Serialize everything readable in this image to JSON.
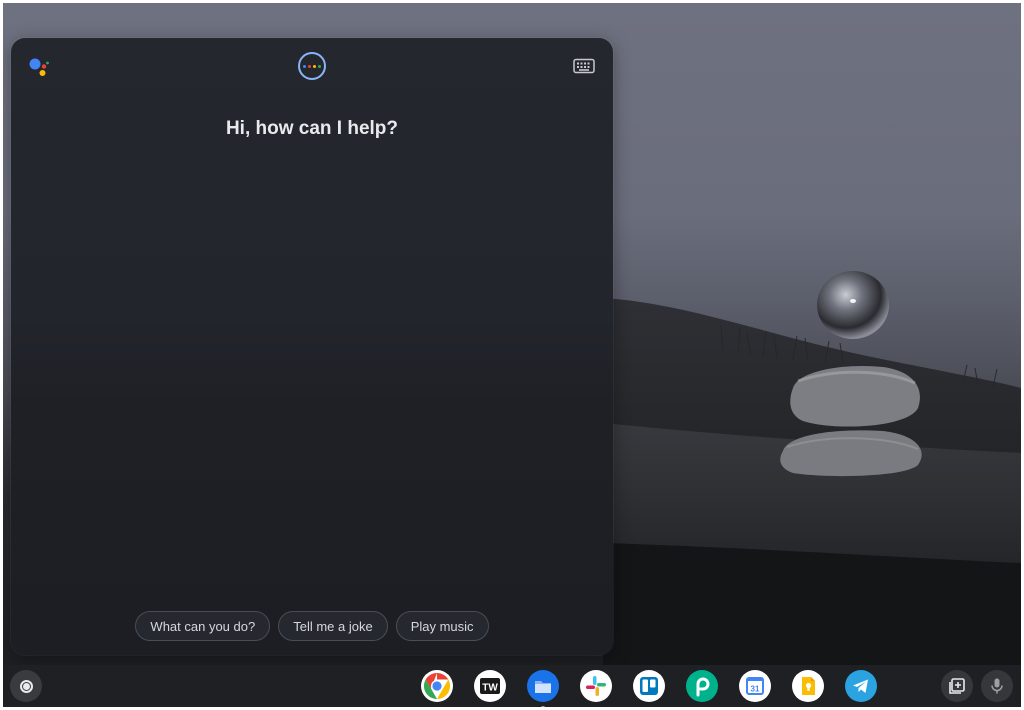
{
  "assistant": {
    "greeting": "Hi, how can I help?",
    "suggestions": [
      "What can you do?",
      "Tell me a joke",
      "Play music"
    ],
    "listening_dot_colors": [
      "#4285f4",
      "#ea4335",
      "#fbbc04",
      "#34a853"
    ]
  },
  "shelf": {
    "apps": [
      {
        "icon": "chrome-icon"
      },
      {
        "icon": "techwiser-icon",
        "text": "TW"
      },
      {
        "icon": "files-icon"
      },
      {
        "icon": "slack-icon"
      },
      {
        "icon": "trello-icon"
      },
      {
        "icon": "picsart-icon"
      },
      {
        "icon": "google-calendar-icon",
        "text": "31"
      },
      {
        "icon": "google-keep-icon"
      },
      {
        "icon": "telegram-icon"
      }
    ]
  },
  "colors": {
    "accent": "#8ab4f8",
    "panel_bg": "#23252c",
    "shelf_bg": "#1f2023"
  }
}
